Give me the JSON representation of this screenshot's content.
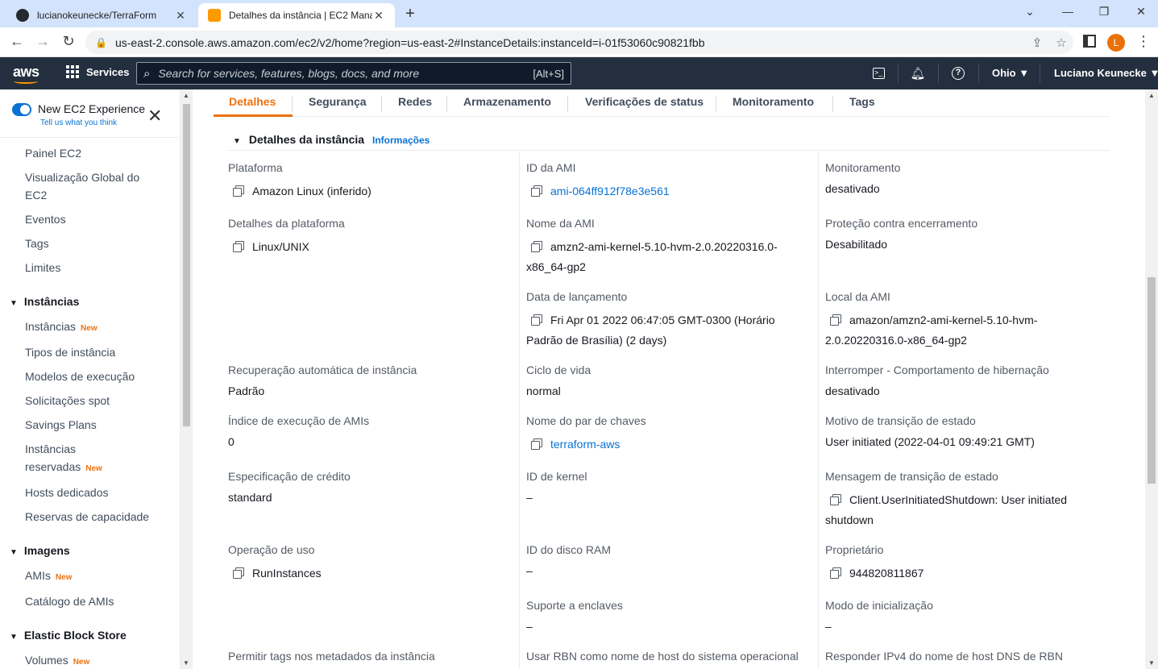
{
  "browser": {
    "tabs": [
      {
        "title": "lucianokeunecke/TerraForm",
        "active": false
      },
      {
        "title": "Detalhes da instância | EC2 Mana",
        "active": true
      }
    ],
    "url": "us-east-2.console.aws.amazon.com/ec2/v2/home?region=us-east-2#InstanceDetails:instanceId=i-01f53060c90821fbb",
    "profile_initial": "L"
  },
  "aws_nav": {
    "logo": "aws",
    "services_label": "Services",
    "search_placeholder": "Search for services, features, blogs, docs, and more",
    "search_shortcut": "[Alt+S]",
    "region": "Ohio ▼",
    "user": "Luciano Keunecke ▼"
  },
  "sidebar": {
    "new_experience_label": "New EC2 Experience",
    "tell_us": "Tell us what you think",
    "top_items": [
      "Painel EC2",
      "Visualização Global do",
      "EC2",
      "Eventos",
      "Tags",
      "Limites"
    ],
    "sections": [
      {
        "title": "Instâncias",
        "items": [
          {
            "label": "Instâncias",
            "badge": "New"
          },
          {
            "label": "Tipos de instância"
          },
          {
            "label": "Modelos de execução"
          },
          {
            "label": "Solicitações spot"
          },
          {
            "label": "Savings Plans"
          },
          {
            "label": "Instâncias",
            "label2": "reservadas",
            "badge": "New"
          },
          {
            "label": "Hosts dedicados"
          },
          {
            "label": "Reservas de capacidade"
          }
        ]
      },
      {
        "title": "Imagens",
        "items": [
          {
            "label": "AMIs",
            "badge": "New"
          },
          {
            "label": "Catálogo de AMIs"
          }
        ]
      },
      {
        "title": "Elastic Block Store",
        "items": [
          {
            "label": "Volumes",
            "badge": "New"
          }
        ]
      }
    ]
  },
  "detail_tabs": [
    "Detalhes",
    "Segurança",
    "Redes",
    "Armazenamento",
    "Verificações de status",
    "Monitoramento",
    "Tags"
  ],
  "section": {
    "title": "Detalhes da instância",
    "info_link": "Informações"
  },
  "fields": {
    "plataforma": {
      "label": "Plataforma",
      "value": "Amazon Linux (inferido)"
    },
    "id_ami": {
      "label": "ID da AMI",
      "value": "ami-064ff912f78e3e561"
    },
    "monitoramento": {
      "label": "Monitoramento",
      "value": "desativado"
    },
    "detalhes_plataforma": {
      "label": "Detalhes da plataforma",
      "value": "Linux/UNIX"
    },
    "nome_ami": {
      "label": "Nome da AMI",
      "value1": "amzn2-ami-kernel-5.10-hvm-2.0.20220316.0-",
      "value2": "x86_64-gp2"
    },
    "protecao": {
      "label": "Proteção contra encerramento",
      "value": "Desabilitado"
    },
    "data_lancamento": {
      "label": "Data de lançamento",
      "value1": "Fri Apr 01 2022 06:47:05 GMT-0300 (Horário",
      "value2": "Padrão de Brasília) (2 days)"
    },
    "local_ami": {
      "label": "Local da AMI",
      "value1": "amazon/amzn2-ami-kernel-5.10-hvm-",
      "value2": "2.0.20220316.0-x86_64-gp2"
    },
    "recuperacao": {
      "label": "Recuperação automática de instância",
      "value": "Padrão"
    },
    "ciclo_vida": {
      "label": "Ciclo de vida",
      "value": "normal"
    },
    "hibernacao": {
      "label": "Interromper - Comportamento de hibernação",
      "value": "desativado"
    },
    "indice_amis": {
      "label": "Índice de execução de AMIs",
      "value": "0"
    },
    "par_chaves": {
      "label": "Nome do par de chaves",
      "value": "terraform-aws"
    },
    "motivo_transicao": {
      "label": "Motivo de transição de estado",
      "value": "User initiated (2022-04-01 09:49:21 GMT)"
    },
    "especificacao_credito": {
      "label": "Especificação de crédito",
      "value": "standard"
    },
    "id_kernel": {
      "label": "ID de kernel",
      "value": "–"
    },
    "mensagem_transicao": {
      "label": "Mensagem de transição de estado",
      "value1": "Client.UserInitiatedShutdown: User initiated",
      "value2": "shutdown"
    },
    "operacao_uso": {
      "label": "Operação de uso",
      "value": "RunInstances"
    },
    "id_disco_ram": {
      "label": "ID do disco RAM",
      "value": "–"
    },
    "proprietario": {
      "label": "Proprietário",
      "value": "944820811867"
    },
    "suporte_enclaves": {
      "label": "Suporte a enclaves",
      "value": "–"
    },
    "modo_inicializacao": {
      "label": "Modo de inicialização",
      "value": "–"
    },
    "permitir_tags": {
      "label": "Permitir tags nos metadados da instância"
    },
    "usar_rbn": {
      "label": "Usar RBN como nome de host do sistema operacional"
    },
    "responder_ipv4": {
      "label": "Responder IPv4 do nome de host DNS de RBN"
    }
  },
  "colors": {
    "accent": "#ec7211",
    "link": "#0972d3",
    "nav_bg": "#232f3e"
  }
}
